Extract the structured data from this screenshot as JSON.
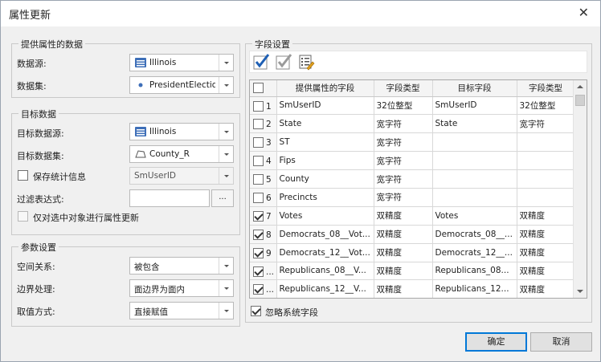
{
  "window": {
    "title": "属性更新"
  },
  "source": {
    "legend": "提供属性的数据",
    "datasource_label": "数据源:",
    "datasource_value": "Illinois",
    "dataset_label": "数据集:",
    "dataset_value": "PresidentElection"
  },
  "target": {
    "legend": "目标数据",
    "datasource_label": "目标数据源:",
    "datasource_value": "Illinois",
    "dataset_label": "目标数据集:",
    "dataset_value": "County_R",
    "save_stats_label": "保存统计信息",
    "stats_field_value": "SmUserID",
    "filter_label": "过滤表达式:",
    "filter_value": "",
    "filter_button": "...",
    "selected_only_label": "仅对选中对象进行属性更新"
  },
  "params": {
    "legend": "参数设置",
    "spatial_label": "空间关系:",
    "spatial_value": "被包含",
    "boundary_label": "边界处理:",
    "boundary_value": "面边界为面内",
    "value_label": "取值方式:",
    "value_value": "直接赋值"
  },
  "fields": {
    "legend": "字段设置",
    "columns": [
      "提供属性的字段",
      "字段类型",
      "目标字段",
      "字段类型"
    ],
    "rows": [
      {
        "num": "1",
        "checked": false,
        "src": "SmUserID",
        "src_type": "32位整型",
        "dst": "SmUserID",
        "dst_type": "32位整型"
      },
      {
        "num": "2",
        "checked": false,
        "src": "State",
        "src_type": "宽字符",
        "dst": "State",
        "dst_type": "宽字符"
      },
      {
        "num": "3",
        "checked": false,
        "src": "ST",
        "src_type": "宽字符",
        "dst": "",
        "dst_type": ""
      },
      {
        "num": "4",
        "checked": false,
        "src": "Fips",
        "src_type": "宽字符",
        "dst": "",
        "dst_type": ""
      },
      {
        "num": "5",
        "checked": false,
        "src": "County",
        "src_type": "宽字符",
        "dst": "",
        "dst_type": ""
      },
      {
        "num": "6",
        "checked": false,
        "src": "Precincts",
        "src_type": "宽字符",
        "dst": "",
        "dst_type": ""
      },
      {
        "num": "7",
        "checked": true,
        "src": "Votes",
        "src_type": "双精度",
        "dst": "Votes",
        "dst_type": "双精度"
      },
      {
        "num": "8",
        "checked": true,
        "src": "Democrats_08__Vot...",
        "src_type": "双精度",
        "dst": "Democrats_08__...",
        "dst_type": "双精度"
      },
      {
        "num": "9",
        "checked": true,
        "src": "Democrats_12__Vot...",
        "src_type": "双精度",
        "dst": "Democrats_12__...",
        "dst_type": "双精度"
      },
      {
        "num": "...",
        "checked": true,
        "src": "Republicans_08__V...",
        "src_type": "双精度",
        "dst": "Republicans_08...",
        "dst_type": "双精度"
      },
      {
        "num": "...",
        "checked": true,
        "src": "Republicans_12__V...",
        "src_type": "双精度",
        "dst": "Republicans_12...",
        "dst_type": "双精度"
      }
    ],
    "ignore_system_label": "忽略系统字段"
  },
  "buttons": {
    "ok": "确定",
    "cancel": "取消"
  },
  "icons": {
    "select_all": "select-all-icon",
    "unselect_all": "unselect-all-icon",
    "invert": "invert-selection-icon"
  },
  "colors": {
    "accent": "#0078d7",
    "check_blue": "#1e5fb4"
  }
}
